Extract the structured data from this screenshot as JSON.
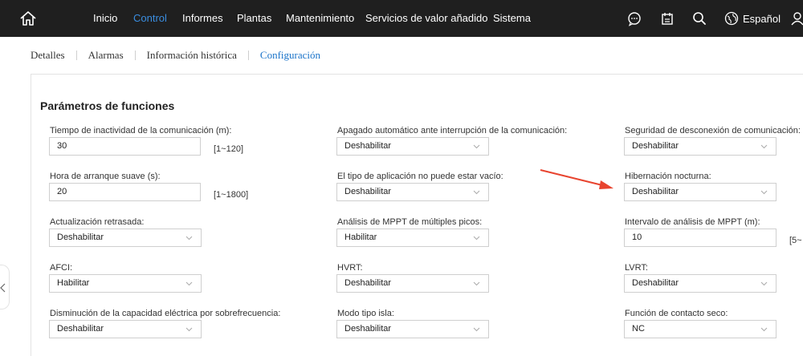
{
  "nav": {
    "items": [
      "Inicio",
      "Control",
      "Informes",
      "Plantas",
      "Mantenimiento",
      "Servicios de valor añadido",
      "Sistema"
    ],
    "active": "Control",
    "language": "Español"
  },
  "subtabs": {
    "items": [
      "Detalles",
      "Alarmas",
      "Información histórica",
      "Configuración"
    ],
    "active": "Configuración"
  },
  "section": {
    "title": "Parámetros de funciones"
  },
  "params": {
    "inactivity": {
      "label": "Tiempo de inactividad de la comunicación (m):",
      "value": "30",
      "range": "[1~120]"
    },
    "shutdown": {
      "label": "Apagado automático ante interrupción de la comunicación:",
      "value": "Deshabilitar"
    },
    "disconnect_security": {
      "label": "Seguridad de desconexión de comunicación:",
      "value": "Deshabilitar"
    },
    "soft_start": {
      "label": "Hora de arranque suave (s):",
      "value": "20",
      "range": "[1~1800]"
    },
    "app_type": {
      "label": "El tipo de aplicación no puede estar vacío:",
      "value": "Deshabilitar"
    },
    "night_hibernation": {
      "label": "Hibernación nocturna:",
      "value": "Deshabilitar"
    },
    "delayed_update": {
      "label": "Actualización retrasada:",
      "value": "Deshabilitar"
    },
    "mppt_multi": {
      "label": "Análisis de MPPT de múltiples picos:",
      "value": "Habilitar"
    },
    "mppt_interval": {
      "label": "Intervalo de análisis de MPPT (m):",
      "value": "10",
      "range": "[5~"
    },
    "afci": {
      "label": "AFCI:",
      "value": "Habilitar"
    },
    "hvrt": {
      "label": "HVRT:",
      "value": "Deshabilitar"
    },
    "lvrt": {
      "label": "LVRT:",
      "value": "Deshabilitar"
    },
    "overfreq": {
      "label": "Disminución de la capacidad eléctrica por sobrefrecuencia:",
      "value": "Deshabilitar"
    },
    "island": {
      "label": "Modo tipo isla:",
      "value": "Deshabilitar"
    },
    "dry_contact": {
      "label": "Función de contacto seco:",
      "value": "NC"
    }
  },
  "colors": {
    "nav_bg": "#1f1f1f",
    "accent": "#3a8de0",
    "annotation_arrow": "#e8442f"
  },
  "icons": [
    "home-icon",
    "chat-icon",
    "calendar-icon",
    "search-icon",
    "globe-icon",
    "user-icon",
    "chevron-down-icon",
    "chevron-left-icon"
  ]
}
